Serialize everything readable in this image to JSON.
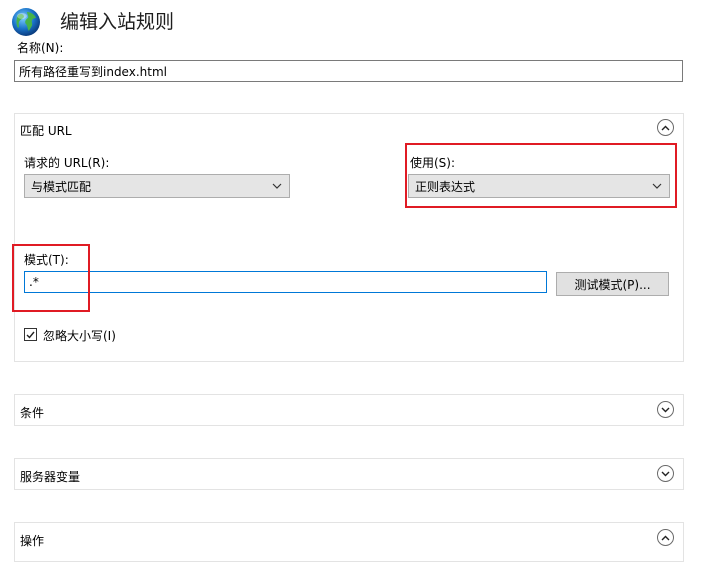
{
  "header": {
    "title": "编辑入站规则"
  },
  "name_field": {
    "label": "名称(N):",
    "value": "所有路径重写到index.html"
  },
  "match_url": {
    "title": "匹配 URL",
    "requested_url": {
      "label": "请求的 URL(R):",
      "selected": "与模式匹配"
    },
    "using": {
      "label": "使用(S):",
      "selected": "正则表达式"
    },
    "pattern": {
      "label": "模式(T):",
      "value": ".*"
    },
    "test_button": "测试模式(P)...",
    "ignore_case": {
      "label": "忽略大小写(I)",
      "checked": true
    }
  },
  "sections": {
    "conditions": "条件",
    "server_variables": "服务器变量",
    "actions": "操作"
  },
  "colors": {
    "highlight_box": "#e01b24",
    "focus_border": "#0078d7"
  }
}
